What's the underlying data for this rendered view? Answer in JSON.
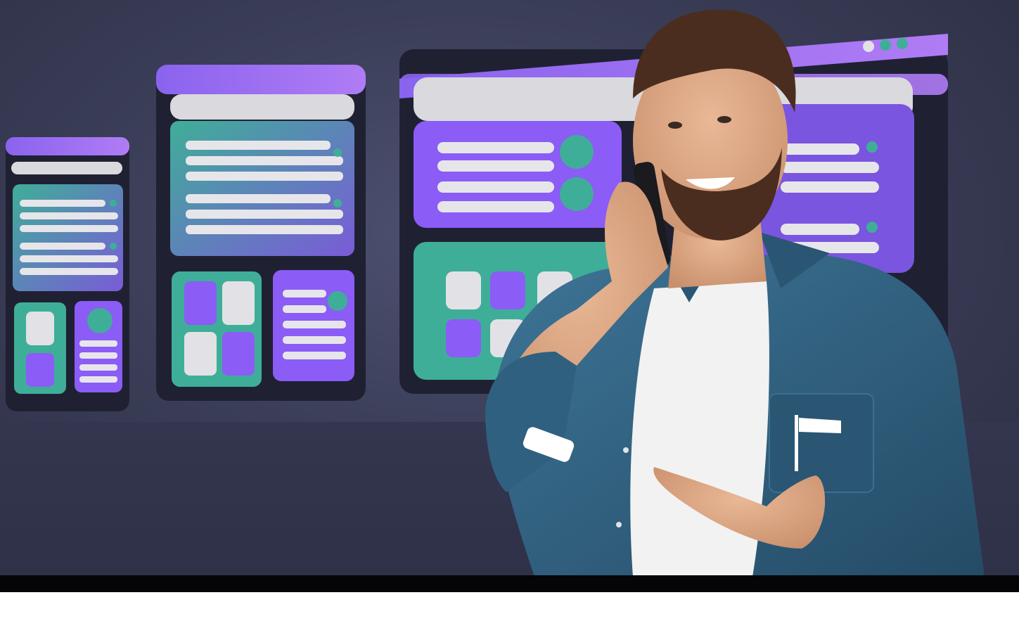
{
  "scene": {
    "subject": "man-on-phone",
    "background_color": "#3b3e58",
    "accent_purple": "#8b5cf6",
    "accent_teal": "#3aa89a",
    "card_dark": "#1f2133",
    "shirt_color": "#2f5f7e",
    "tshirt_color": "#f2f2f2"
  },
  "icons": {
    "window_controls": "three-dot-window-controls",
    "pocket_logo": "flag-logo"
  }
}
